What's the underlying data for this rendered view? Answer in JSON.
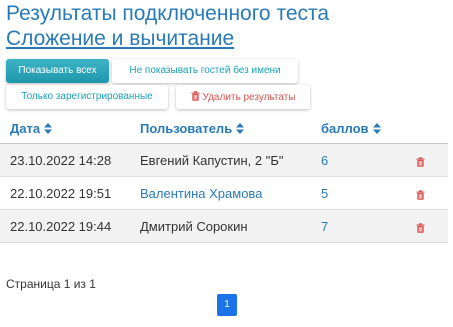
{
  "header": {
    "title": "Результаты подключенного теста",
    "test_link": "Сложение и вычитание"
  },
  "filters": {
    "show_all": "Показывать всех",
    "hide_guests": "Не показывать гостей без имени",
    "registered_only": "Только зарегистрированные",
    "delete_results": "Удалить результаты"
  },
  "table": {
    "headers": {
      "date": "Дата",
      "user": "Пользователь",
      "score": "баллов"
    },
    "rows": [
      {
        "date": "23.10.2022 14:28",
        "user": "Евгений Капустин, 2 \"Б\"",
        "score": "6"
      },
      {
        "date": "22.10.2022 19:51",
        "user": "Валентина Храмова",
        "score": "5"
      },
      {
        "date": "22.10.2022 19:44",
        "user": "Дмитрий Сорокин",
        "score": "7"
      }
    ]
  },
  "pagination": {
    "status": "Страница 1 из 1",
    "current_page": "1"
  },
  "colors": {
    "link": "#2a7ab7",
    "accent": "#1aa2b6",
    "danger": "#d9534f",
    "page_button": "#1a73e8"
  },
  "icons": {
    "sort": "sort-icon",
    "delete": "trash-icon"
  }
}
